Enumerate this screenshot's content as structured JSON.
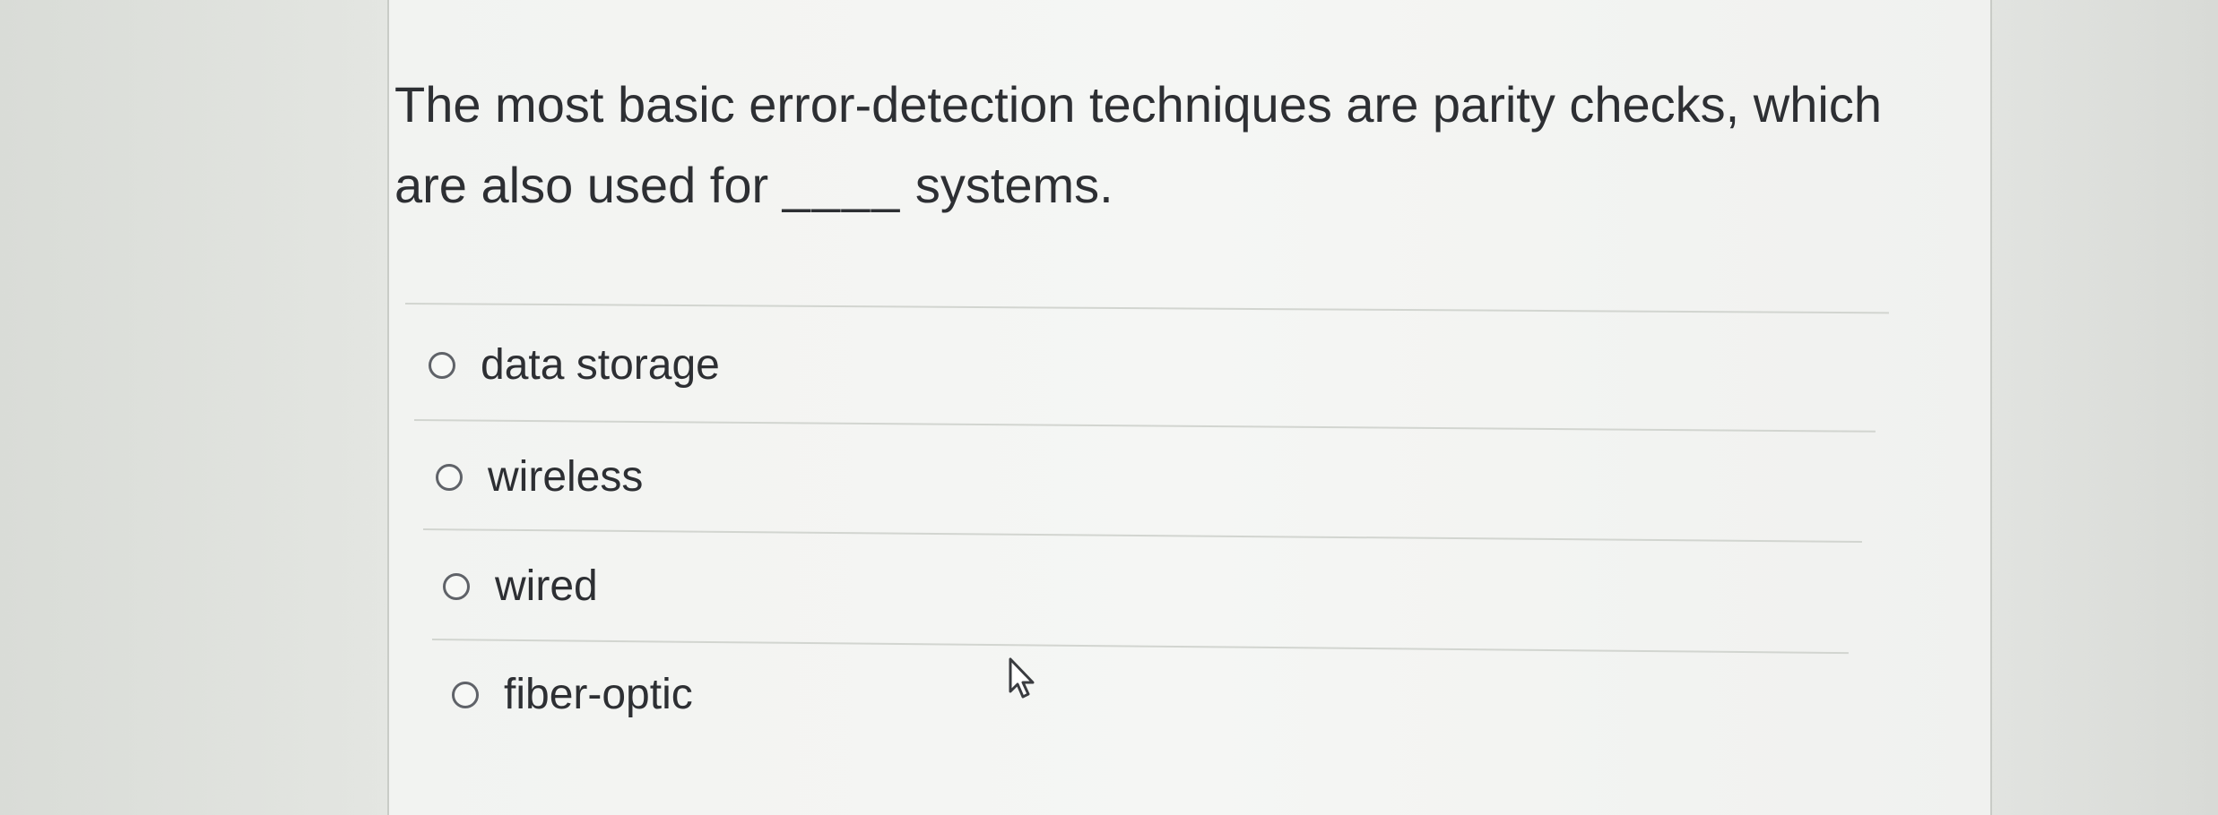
{
  "question": {
    "text_before": "The most basic error-detection techniques are parity checks, which are also used for ",
    "blank": "____",
    "text_after": " systems."
  },
  "options": [
    {
      "label": "data storage",
      "selected": false
    },
    {
      "label": "wireless",
      "selected": false
    },
    {
      "label": "wired",
      "selected": false
    },
    {
      "label": "fiber-optic",
      "selected": false
    }
  ],
  "icons": {
    "radio": "radio-unchecked-icon",
    "cursor": "mouse-pointer-icon"
  },
  "colors": {
    "text": "#2d2f33",
    "radio_border": "#5f6268",
    "divider": "#d2d5d0"
  }
}
